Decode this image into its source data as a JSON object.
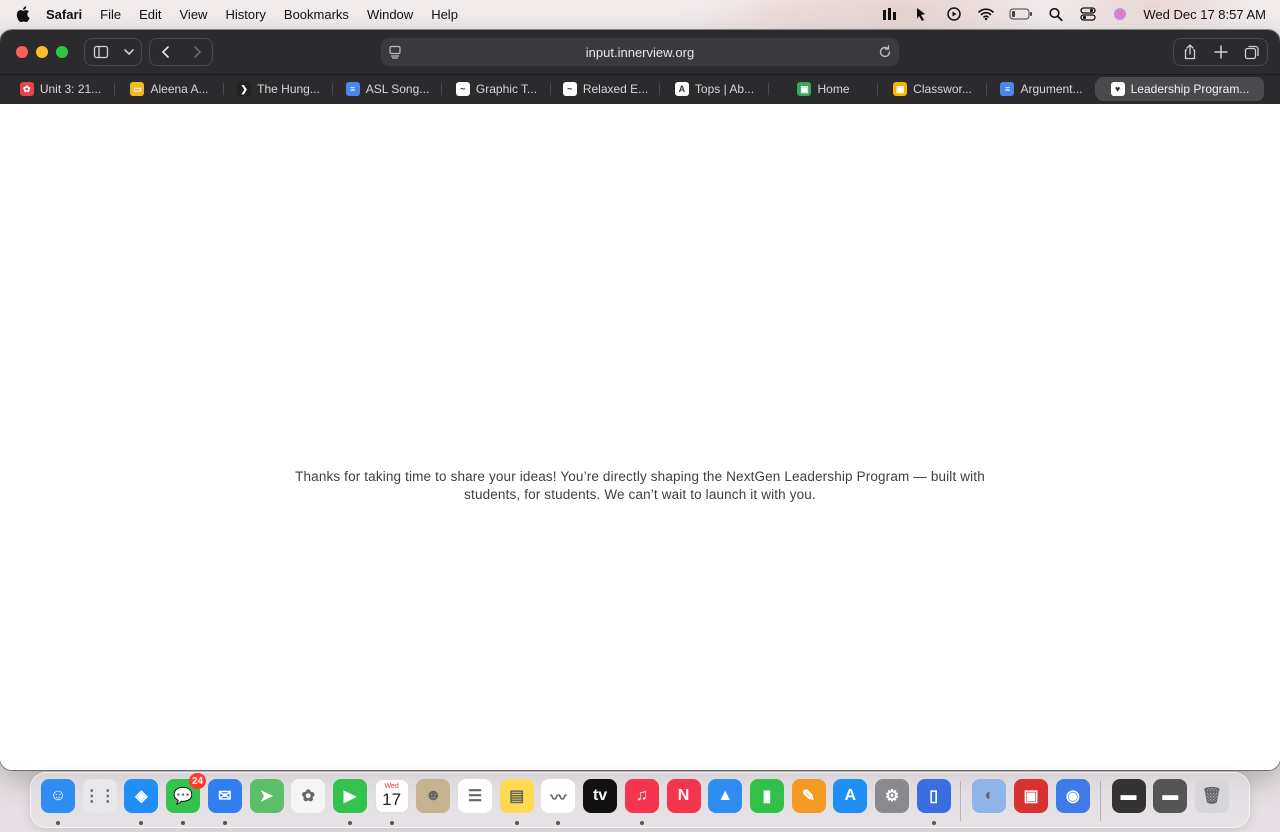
{
  "menubar": {
    "app_name": "Safari",
    "items": [
      "File",
      "Edit",
      "View",
      "History",
      "Bookmarks",
      "Window",
      "Help"
    ],
    "clock": "Wed Dec 17  8:57 AM"
  },
  "toolbar": {
    "url": "input.innerview.org"
  },
  "tabs": [
    {
      "label": "Unit 3: 21...",
      "favicon_color": "#e8434b",
      "favicon_glyph": "✿"
    },
    {
      "label": "Aleena A...",
      "favicon_color": "#f5b820",
      "favicon_glyph": "▭"
    },
    {
      "label": "The Hung...",
      "favicon_color": "#222222",
      "favicon_glyph": "❯"
    },
    {
      "label": "ASL Song...",
      "favicon_color": "#4a86f0",
      "favicon_glyph": "≡"
    },
    {
      "label": "Graphic T...",
      "favicon_color": "#ffffff",
      "favicon_glyph": "~"
    },
    {
      "label": "Relaxed E...",
      "favicon_color": "#ffffff",
      "favicon_glyph": "~"
    },
    {
      "label": "Tops | Ab...",
      "favicon_color": "#ffffff",
      "favicon_glyph": "A"
    },
    {
      "label": "Home",
      "favicon_color": "#3aa55d",
      "favicon_glyph": "▣"
    },
    {
      "label": "Classwor...",
      "favicon_color": "#f4b400",
      "favicon_glyph": "▣"
    },
    {
      "label": "Argument...",
      "favicon_color": "#4a86f0",
      "favicon_glyph": "≡"
    },
    {
      "label": "Leadership Program...",
      "favicon_color": "#ffffff",
      "favicon_glyph": "♥",
      "active": true
    }
  ],
  "page": {
    "message_line1": "Thanks for taking  time to share your ideas! You’re directly shaping the NextGen Leadership Program — built with",
    "message_line2": "students, for students. We can’t wait to launch it with you."
  },
  "dock": {
    "messages_badge": "24",
    "calendar_day": "Wed",
    "calendar_date": "17",
    "apps": [
      {
        "name": "finder-icon",
        "color": "#2f8cf0"
      },
      {
        "name": "launchpad-icon",
        "color": "#e8e8ec"
      },
      {
        "name": "safari-icon",
        "color": "#1f8ef5"
      },
      {
        "name": "messages-icon",
        "color": "#32c24d"
      },
      {
        "name": "mail-icon",
        "color": "#2f7ff0"
      },
      {
        "name": "maps-icon",
        "color": "#5bbf6a"
      },
      {
        "name": "photos-icon",
        "color": "#f5f5f5"
      },
      {
        "name": "facetime-icon",
        "color": "#32c24d"
      },
      {
        "name": "calendar-icon",
        "color": "#ffffff"
      },
      {
        "name": "contacts-icon",
        "color": "#c7b28f"
      },
      {
        "name": "reminders-icon",
        "color": "#ffffff"
      },
      {
        "name": "notes-icon",
        "color": "#ffd952"
      },
      {
        "name": "freeform-icon",
        "color": "#ffffff"
      },
      {
        "name": "apple-tv-icon",
        "color": "#111111"
      },
      {
        "name": "music-icon",
        "color": "#f5354d"
      },
      {
        "name": "news-icon",
        "color": "#f5354d"
      },
      {
        "name": "keynote-icon",
        "color": "#2f8cf0"
      },
      {
        "name": "numbers-icon",
        "color": "#31c14a"
      },
      {
        "name": "pages-icon",
        "color": "#f59a23"
      },
      {
        "name": "app-store-icon",
        "color": "#1f8ef5"
      },
      {
        "name": "system-settings-icon",
        "color": "#8a8a8e"
      },
      {
        "name": "iphone-mirroring-icon",
        "color": "#3a6ee0"
      },
      {
        "name": "utility-app-icon",
        "color": "#8fb4e8"
      },
      {
        "name": "photo-booth-icon",
        "color": "#d93030"
      },
      {
        "name": "disk-utility-icon",
        "color": "#3f7be8"
      },
      {
        "name": "recent-window-1-icon",
        "color": "#333333"
      },
      {
        "name": "recent-window-2-icon",
        "color": "#555555"
      },
      {
        "name": "trash-icon",
        "color": "#d6d6da"
      }
    ]
  }
}
